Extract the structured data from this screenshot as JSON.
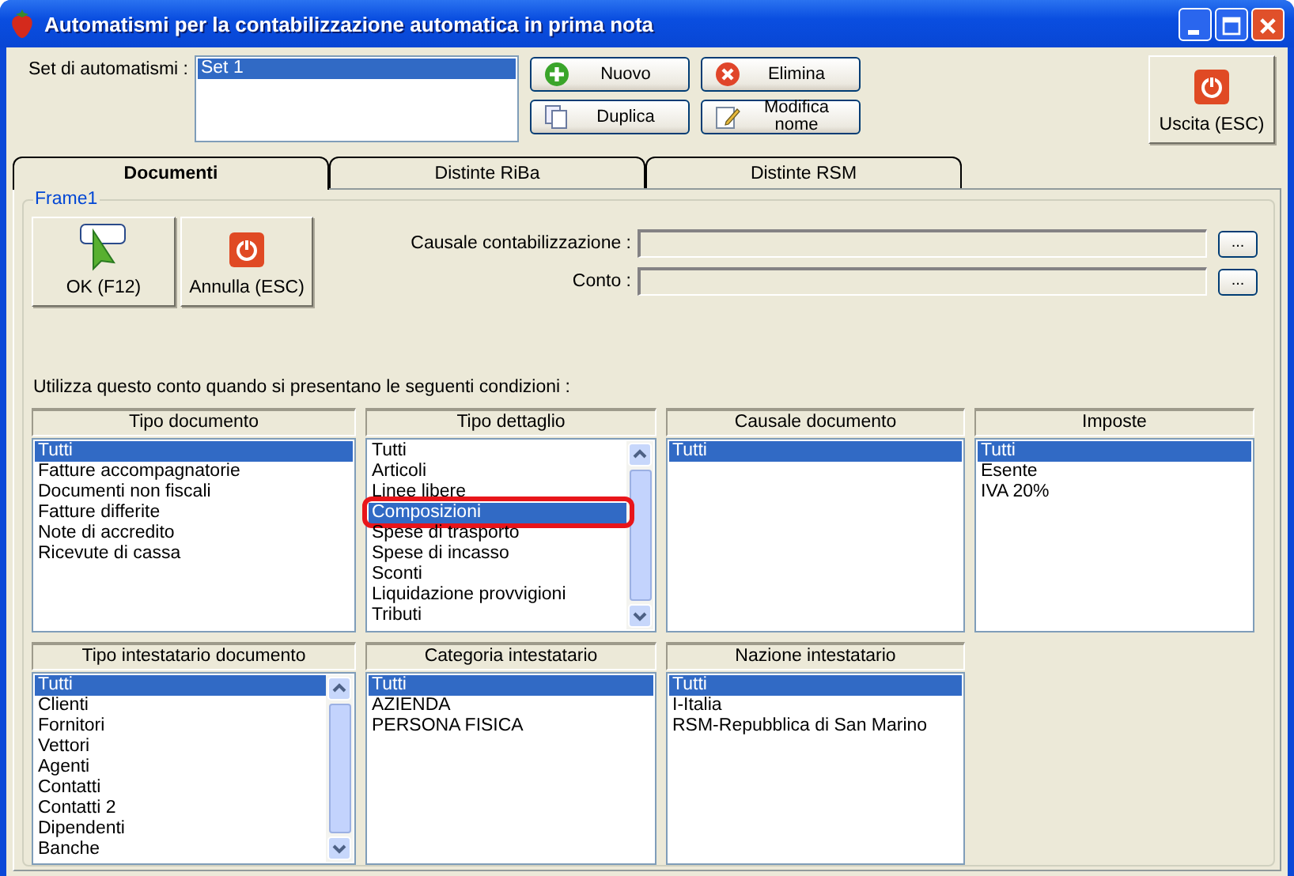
{
  "window": {
    "title": "Automatismi per la contabilizzazione automatica in prima nota"
  },
  "set_automatismi": {
    "label": "Set di automatismi :",
    "items": [
      {
        "label": "Set 1",
        "selected": true
      }
    ]
  },
  "buttons": [
    {
      "label": "Nuovo",
      "kind": "add"
    },
    {
      "label": "Elimina",
      "kind": "remove"
    },
    {
      "label": "Duplica",
      "kind": "copy"
    },
    {
      "label": "Modifica nome",
      "kind": "edit"
    }
  ],
  "exit_button": {
    "label": "Uscita (ESC)"
  },
  "tabs": [
    {
      "label": "Documenti",
      "selected": true
    },
    {
      "label": "Distinte RiBa",
      "selected": false
    },
    {
      "label": "Distinte RSM",
      "selected": false
    }
  ],
  "frame": {
    "title": "Frame1",
    "actions": [
      {
        "label": "OK (F12)",
        "kind": "ok"
      },
      {
        "label": "Annulla (ESC)",
        "kind": "exit"
      }
    ],
    "fields": [
      {
        "label": "Causale contabilizzazione :",
        "button": "..."
      },
      {
        "label": "Conto :",
        "button": "..."
      }
    ],
    "instruction": "Utilizza questo conto quando si presentano le seguenti condizioni :",
    "lists": [
      {
        "title": "Tipo documento",
        "scrollbar": false,
        "items": [
          {
            "label": "Tutti",
            "selected": true
          },
          {
            "label": "Fatture accompagnatorie",
            "selected": false
          },
          {
            "label": "Documenti non fiscali",
            "selected": false
          },
          {
            "label": "Fatture differite",
            "selected": false
          },
          {
            "label": "Note di accredito",
            "selected": false
          },
          {
            "label": "Ricevute di cassa",
            "selected": false
          }
        ]
      },
      {
        "title": "Tipo dettaglio",
        "scrollbar": true,
        "items": [
          {
            "label": "Tutti",
            "selected": false,
            "highlighted": false
          },
          {
            "label": "Articoli",
            "selected": false,
            "highlighted": false
          },
          {
            "label": "Linee libere",
            "selected": false,
            "highlighted": false
          },
          {
            "label": "Composizioni",
            "selected": true,
            "highlighted": true
          },
          {
            "label": "Spese di trasporto",
            "selected": false,
            "highlighted": false
          },
          {
            "label": "Spese di incasso",
            "selected": false,
            "highlighted": false
          },
          {
            "label": "Sconti",
            "selected": false,
            "highlighted": false
          },
          {
            "label": "Liquidazione provvigioni",
            "selected": false,
            "highlighted": false
          },
          {
            "label": "Tributi",
            "selected": false,
            "highlighted": false
          }
        ]
      },
      {
        "title": "Causale documento",
        "scrollbar": false,
        "items": [
          {
            "label": "Tutti",
            "selected": true
          }
        ]
      },
      {
        "title": "Imposte",
        "scrollbar": false,
        "items": [
          {
            "label": "Tutti",
            "selected": true
          },
          {
            "label": "Esente",
            "selected": false
          },
          {
            "label": "IVA 20%",
            "selected": false
          }
        ]
      },
      {
        "title": "Tipo intestatario documento",
        "scrollbar": true,
        "items": [
          {
            "label": "Tutti",
            "selected": true
          },
          {
            "label": "Clienti",
            "selected": false
          },
          {
            "label": "Fornitori",
            "selected": false
          },
          {
            "label": "Vettori",
            "selected": false
          },
          {
            "label": "Agenti",
            "selected": false
          },
          {
            "label": "Contatti",
            "selected": false
          },
          {
            "label": "Contatti 2",
            "selected": false
          },
          {
            "label": "Dipendenti",
            "selected": false
          },
          {
            "label": "Banche",
            "selected": false
          }
        ]
      },
      {
        "title": "Categoria intestatario",
        "scrollbar": false,
        "items": [
          {
            "label": "Tutti",
            "selected": true
          },
          {
            "label": "AZIENDA",
            "selected": false
          },
          {
            "label": "PERSONA FISICA",
            "selected": false
          }
        ]
      },
      {
        "title": "Nazione intestatario",
        "scrollbar": false,
        "items": [
          {
            "label": "Tutti",
            "selected": true
          },
          {
            "label": "I-Italia",
            "selected": false
          },
          {
            "label": "RSM-Repubblica di San Marino",
            "selected": false
          }
        ]
      }
    ]
  }
}
